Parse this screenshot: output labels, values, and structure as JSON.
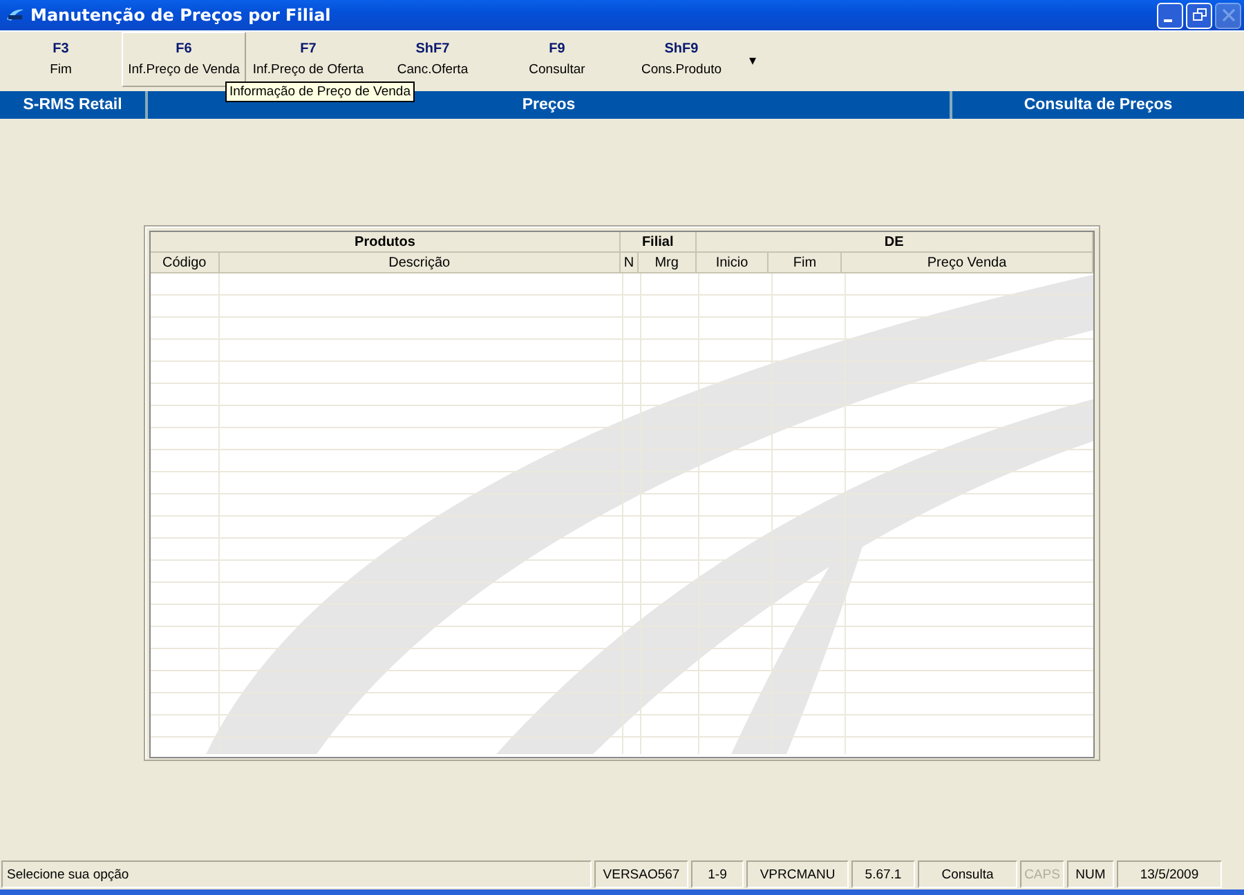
{
  "window": {
    "title": "Manutenção de Preços por Filial",
    "controls": [
      {
        "kind": "minimize",
        "disabled": false
      },
      {
        "kind": "restore",
        "disabled": false
      },
      {
        "kind": "close",
        "disabled": true
      }
    ]
  },
  "toolbar": {
    "buttons": [
      {
        "key": "F3",
        "label": "Fim",
        "hovered": false
      },
      {
        "key": "F6",
        "label": "Inf.Preço de Venda",
        "hovered": true
      },
      {
        "key": "F7",
        "label": "Inf.Preço de Oferta",
        "hovered": false
      },
      {
        "key": "ShF7",
        "label": "Canc.Oferta",
        "hovered": false
      },
      {
        "key": "F9",
        "label": "Consultar",
        "hovered": false
      },
      {
        "key": "ShF9",
        "label": "Cons.Produto",
        "hovered": false
      }
    ],
    "more_caret": "▾",
    "tooltip": "Informação de Preço de Venda"
  },
  "header_bar": {
    "app": "S-RMS Retail",
    "section": "Preços",
    "mode": "Consulta de Preços"
  },
  "table": {
    "groups": [
      "Produtos",
      "Filial",
      "DE"
    ],
    "columns": [
      "Código",
      "Descrição",
      "N",
      "Mrg",
      "Inicio",
      "Fim",
      "Preço Venda"
    ]
  },
  "status_bar": {
    "message": "Selecione sua opção",
    "panels": [
      {
        "text": "VERSAO567",
        "disabled": false
      },
      {
        "text": "1-9",
        "disabled": false
      },
      {
        "text": "VPRCMANU",
        "disabled": false
      },
      {
        "text": "5.67.1",
        "disabled": false
      },
      {
        "text": "Consulta",
        "disabled": false
      },
      {
        "text": "CAPS",
        "disabled": true
      },
      {
        "text": "NUM",
        "disabled": false
      },
      {
        "text": "13/5/2009",
        "disabled": false
      }
    ]
  }
}
